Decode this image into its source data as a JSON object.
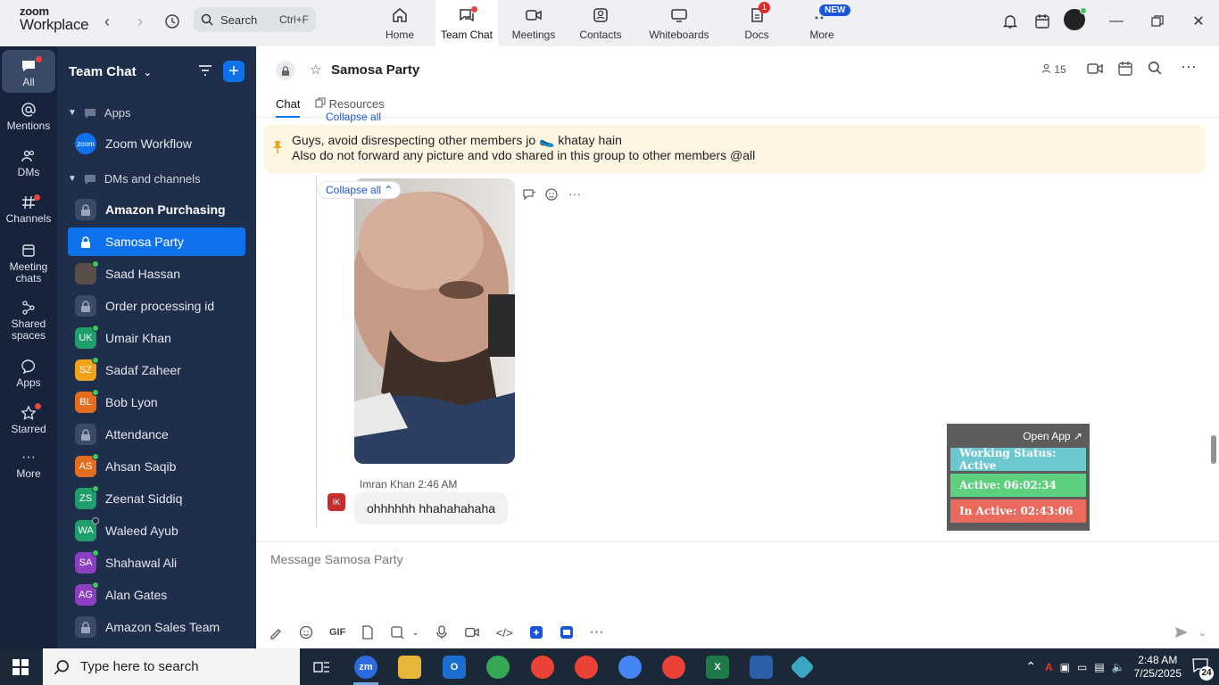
{
  "app": {
    "logo_line1": "zoom",
    "logo_line2": "Workplace"
  },
  "search": {
    "label": "Search",
    "shortcut": "Ctrl+F"
  },
  "tabs": [
    {
      "label": "Home",
      "icon": "home-icon"
    },
    {
      "label": "Team Chat",
      "icon": "chat-icon",
      "active": true
    },
    {
      "label": "Meetings",
      "icon": "video-icon"
    },
    {
      "label": "Contacts",
      "icon": "contacts-icon"
    },
    {
      "label": "Whiteboards",
      "icon": "whiteboard-icon"
    },
    {
      "label": "Docs",
      "icon": "docs-icon",
      "badge": "1"
    },
    {
      "label": "More",
      "icon": "more-icon",
      "badge": "NEW"
    }
  ],
  "rail": [
    {
      "label": "All",
      "icon": "chat-bubble-icon"
    },
    {
      "label": "Mentions",
      "icon": "at-icon"
    },
    {
      "label": "DMs",
      "icon": "people-icon"
    },
    {
      "label": "Channels",
      "icon": "hash-icon"
    },
    {
      "label": "Meeting chats",
      "icon": "calendar-icon"
    },
    {
      "label": "Shared spaces",
      "icon": "share-icon"
    },
    {
      "label": "Apps",
      "icon": "apps-bubble-icon"
    },
    {
      "label": "Starred",
      "icon": "star-icon"
    },
    {
      "label": "More",
      "icon": "ellipsis-icon"
    }
  ],
  "sidebar": {
    "title": "Team Chat",
    "section_apps": "Apps",
    "apps": [
      {
        "label": "Zoom Workflow",
        "avatar": "zoom"
      }
    ],
    "section_dms": "DMs and channels",
    "items": [
      {
        "label": "Amazon Purchasing",
        "type": "lock",
        "bold": true
      },
      {
        "label": "Samosa Party",
        "type": "lock",
        "selected": true
      },
      {
        "label": "Saad Hassan",
        "type": "photo",
        "status": "online"
      },
      {
        "label": "Order processing id",
        "type": "lock"
      },
      {
        "label": "Umair Khan",
        "initials": "UK",
        "color": "#1e9e6a",
        "status": "online"
      },
      {
        "label": "Sadaf Zaheer",
        "initials": "SZ",
        "color": "#f0a21b",
        "status": "online"
      },
      {
        "label": "Bob Lyon",
        "initials": "BL",
        "color": "#e56d1f",
        "status": "online"
      },
      {
        "label": "Attendance",
        "type": "lock"
      },
      {
        "label": "Ahsan Saqib",
        "initials": "AS",
        "color": "#e56d1f",
        "status": "online"
      },
      {
        "label": "Zeenat Siddiq",
        "initials": "ZS",
        "color": "#1e9e6a",
        "status": "online"
      },
      {
        "label": "Waleed Ayub",
        "initials": "WA",
        "color": "#1e9e6a",
        "status": "offline"
      },
      {
        "label": "Shahawal Ali",
        "initials": "SA",
        "color": "#8c3fc2",
        "status": "online"
      },
      {
        "label": "Alan Gates",
        "initials": "AG",
        "color": "#8c3fc2",
        "status": "online"
      },
      {
        "label": "Amazon Sales Team",
        "type": "lock"
      }
    ]
  },
  "channel": {
    "title": "Samosa Party",
    "member_count": "15",
    "tabs": {
      "chat": "Chat",
      "resources": "Resources"
    },
    "pinned": {
      "line1": "Guys, avoid disrespecting other members jo 🥿 khatay hain",
      "line2": "Also do not forward any picture and vdo shared in this group to other members @all"
    },
    "collapse_label": "Collapse all",
    "message": {
      "sender": "Imran Khan",
      "time": "2:46 AM",
      "initials": "IK",
      "text": "ohhhhhh hhahahahaha"
    },
    "compose_placeholder": "Message Samosa Party"
  },
  "widget": {
    "open_app": "Open App ↗",
    "working_status": "Working Status: Active",
    "active": "Active: 06:02:34",
    "inactive": "In Active: 02:43:06",
    "colors": {
      "status": "#6cc7cf",
      "active": "#5ecf7c",
      "inactive": "#ea6a5e"
    }
  },
  "taskbar": {
    "search_placeholder": "Type here to search",
    "time": "2:48 AM",
    "date": "7/25/2025",
    "notifications": "24"
  }
}
